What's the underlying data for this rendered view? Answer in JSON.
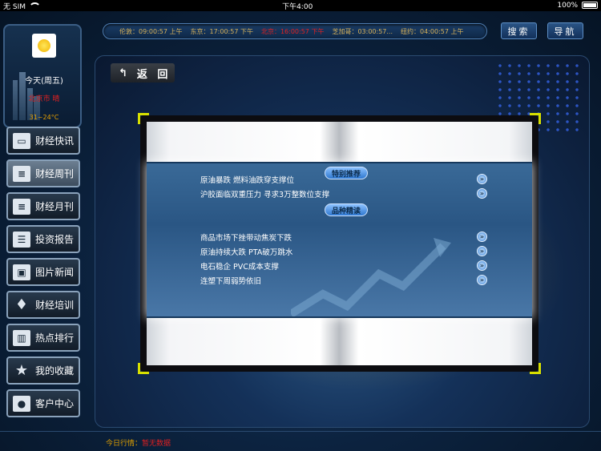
{
  "status_bar": {
    "carrier": "无 SIM",
    "time": "下午4:00",
    "battery": "100%"
  },
  "ticker": {
    "items": [
      {
        "text": "伦敦：09:00:57 上午",
        "highlight": false
      },
      {
        "text": "东京：17:00:57 下午",
        "highlight": false
      },
      {
        "text": "北京：16:00:57 下午",
        "highlight": true
      },
      {
        "text": "芝加哥：03:00:57...",
        "highlight": false
      },
      {
        "text": "纽约：04:00:57 上午",
        "highlight": false
      }
    ]
  },
  "header": {
    "search_label": "搜索",
    "nav_label": "导航"
  },
  "weather": {
    "day": "今天(周五)",
    "city": "北京市 晴",
    "temp": "31~24°C",
    "icon": "sun-icon"
  },
  "sidebar": {
    "items": [
      {
        "label": "财经快讯",
        "icon": "monitor-icon",
        "active": false
      },
      {
        "label": "财经周刊",
        "icon": "document-icon",
        "active": true
      },
      {
        "label": "财经月刊",
        "icon": "document-icon",
        "active": false
      },
      {
        "label": "投资报告",
        "icon": "report-icon",
        "active": false
      },
      {
        "label": "图片新闻",
        "icon": "picture-icon",
        "active": false
      },
      {
        "label": "财经培训",
        "icon": "graduation-cap-icon",
        "active": false
      },
      {
        "label": "热点排行",
        "icon": "bar-chart-icon",
        "active": false
      },
      {
        "label": "我的收藏",
        "icon": "star-icon",
        "active": false
      },
      {
        "label": "客户中心",
        "icon": "user-icon",
        "active": false
      }
    ]
  },
  "main": {
    "back_label": "返 回",
    "sections": [
      {
        "title": "特别推荐",
        "articles": [
          "原油暴跌 燃料油跌穿支撑位",
          "沪胶面临双重压力 寻求3万整数位支撑"
        ]
      },
      {
        "title": "品种精读",
        "articles": [
          "商品市场下挫带动焦炭下跌",
          "原油持续大跌 PTA破万跳水",
          "电石稳企 PVC成本支撑",
          "连塑下周弱势依旧"
        ]
      }
    ]
  },
  "footer": {
    "label": "今日行情：",
    "value": "暂无数据"
  }
}
